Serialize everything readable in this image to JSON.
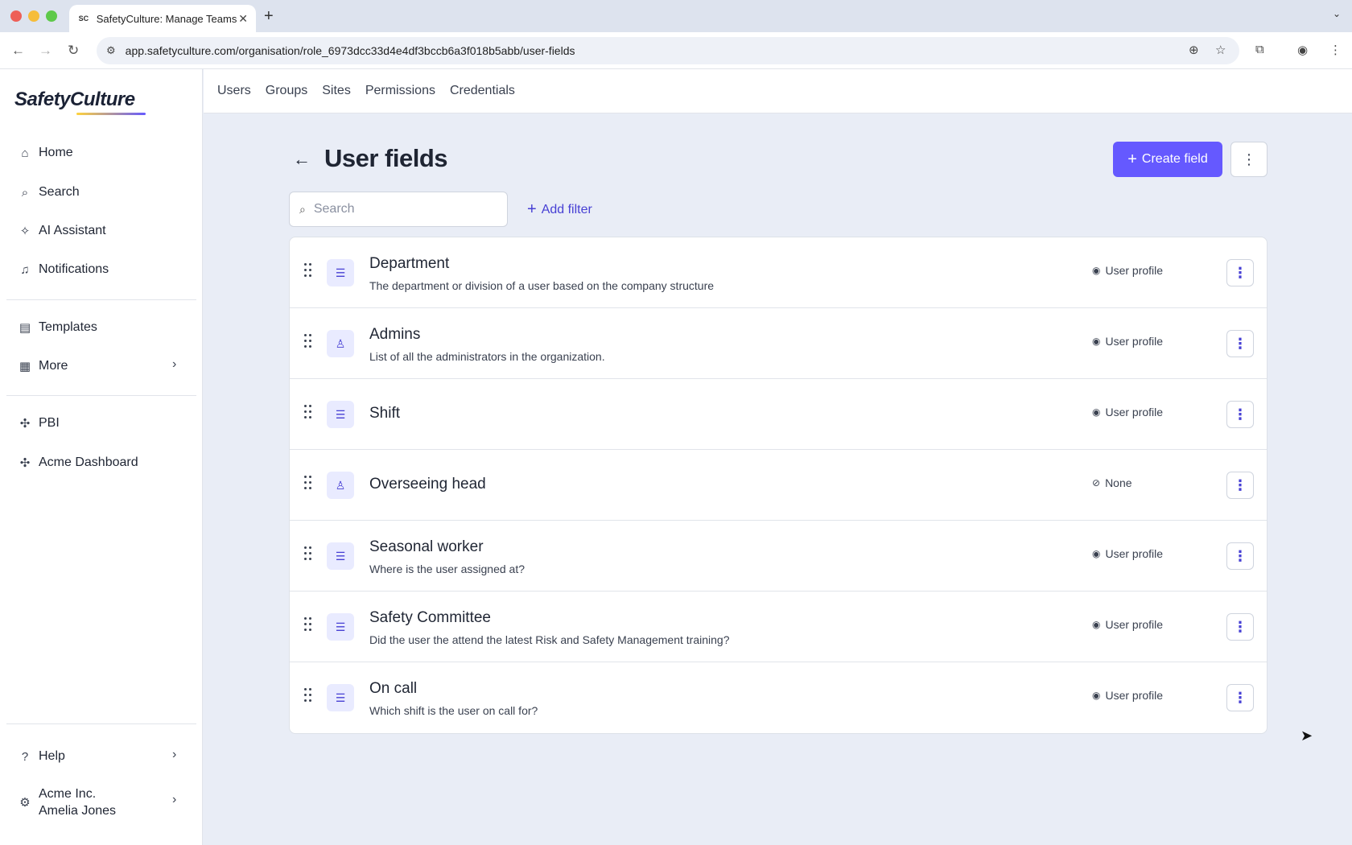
{
  "browser": {
    "tab_title": "SafetyCulture: Manage Teams",
    "tab_favicon": "SC",
    "url": "app.safetyculture.com/organisation/role_6973dcc33d4e4df3bccb6a3f018b5abb/user-fields"
  },
  "sidebar": {
    "logo": "SafetyCulture",
    "items_top": [
      {
        "label": "Home",
        "icon": "home-icon"
      },
      {
        "label": "Search",
        "icon": "search-icon"
      },
      {
        "label": "AI Assistant",
        "icon": "sparkle-icon"
      },
      {
        "label": "Notifications",
        "icon": "bell-icon"
      }
    ],
    "items_middle": [
      {
        "label": "Templates",
        "icon": "template-icon"
      },
      {
        "label": "More",
        "icon": "grid-icon"
      }
    ],
    "items_bottom": [
      {
        "label": "PBI",
        "icon": "puzzle-icon"
      },
      {
        "label": "Acme Dashboard",
        "icon": "puzzle-icon"
      }
    ],
    "help": "Help",
    "org_name": "Acme Inc.",
    "user_name": "Amelia Jones"
  },
  "topnav": [
    "Users",
    "Groups",
    "Sites",
    "Permissions",
    "Credentials"
  ],
  "page": {
    "title": "User fields",
    "create_label": "Create field",
    "search_placeholder": "Search",
    "add_filter_label": "Add filter"
  },
  "fields": [
    {
      "name": "Department",
      "description": "The department or division of a user based on the company structure",
      "type": "list",
      "visibility": "User profile"
    },
    {
      "name": "Admins",
      "description": "List of all the administrators in the organization.",
      "type": "user",
      "visibility": "User profile"
    },
    {
      "name": "Shift",
      "description": "",
      "type": "list",
      "visibility": "User profile"
    },
    {
      "name": "Overseeing head",
      "description": "",
      "type": "user",
      "visibility": "None"
    },
    {
      "name": "Seasonal worker",
      "description": "Where is the user assigned at?",
      "type": "list",
      "visibility": "User profile"
    },
    {
      "name": "Safety Committee",
      "description": "Did the user the attend the latest Risk and Safety Management training?",
      "type": "list",
      "visibility": "User profile"
    },
    {
      "name": "On call",
      "description": "Which shift is the user on call for?",
      "type": "list",
      "visibility": "User profile"
    }
  ],
  "colors": {
    "accent": "#6559ff",
    "accent_text": "#4740d4",
    "page_bg": "#e9edf6"
  }
}
